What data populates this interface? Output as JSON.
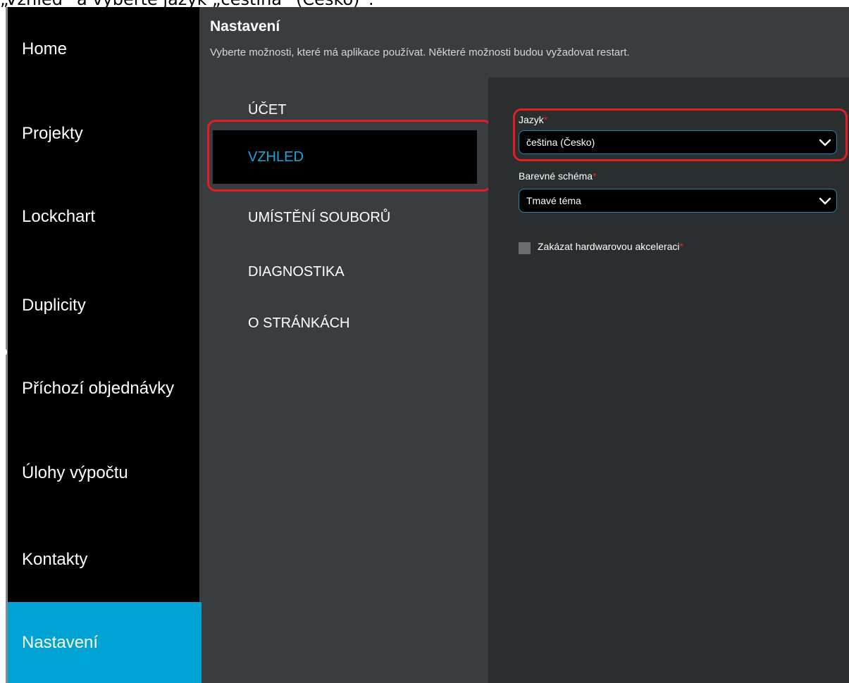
{
  "caption": "„Vzhled“ a vyberte jazyk „čeština“ (Česko)“.",
  "sidebar": {
    "items": [
      {
        "label": "Home"
      },
      {
        "label": "Projekty"
      },
      {
        "label": "Lockchart"
      },
      {
        "label": "Duplicity"
      },
      {
        "label": "Příchozí objednávky"
      },
      {
        "label": "Úlohy výpočtu"
      },
      {
        "label": "Kontakty"
      },
      {
        "label": "Nastavení",
        "active": true
      }
    ]
  },
  "header": {
    "title": "Nastavení",
    "description": "Vyberte možnosti, které má aplikace používat. Některé možnosti budou vyžadovat restart."
  },
  "categories": [
    {
      "label": "ÚČET"
    },
    {
      "label": "VZHLED",
      "selected": true
    },
    {
      "label": "UMÍSTĚNÍ SOUBORŮ"
    },
    {
      "label": "DIAGNOSTIKA"
    },
    {
      "label": "O STRÁNKÁCH"
    }
  ],
  "appearance": {
    "language": {
      "label": "Jazyk",
      "required_mark": "*",
      "value": "čeština (Česko)"
    },
    "color_scheme": {
      "label": "Barevné schéma",
      "required_mark": "*",
      "value": "Tmavé téma"
    },
    "hw_acceleration": {
      "label": "Zakázat hardwarovou akceleraci",
      "required_mark": "*",
      "checked": false
    }
  },
  "colors": {
    "accent": "#00a3d3",
    "selected_text": "#1aa6d8",
    "highlight": "#e01e24",
    "required": "#e0242b"
  },
  "icons": {
    "dropdown": "chevron-down-icon"
  }
}
